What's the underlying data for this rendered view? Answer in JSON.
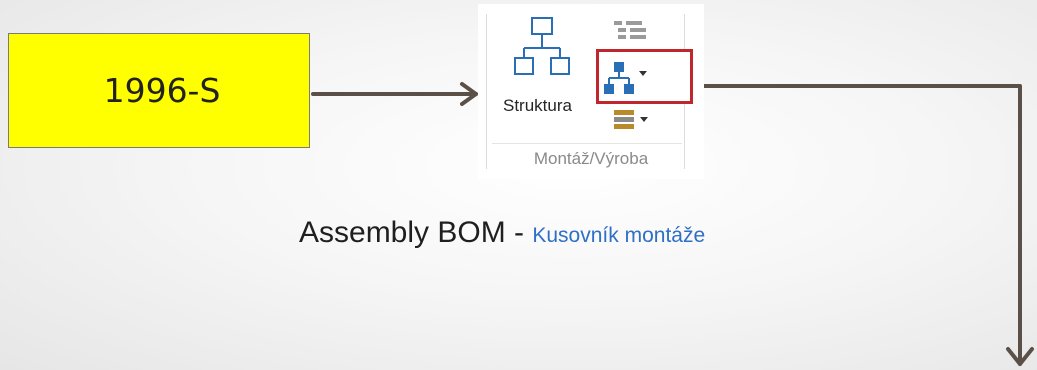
{
  "item_box": {
    "code": "1996-S",
    "color": "#ffff00"
  },
  "ribbon": {
    "struktura_label": "Struktura",
    "group_label": "Montáž/Výroba",
    "highlight_color": "#c0272d",
    "icons": {
      "struktura": "org-chart-icon",
      "top": "list-structure-icon",
      "middle": "hierarchy-icon",
      "bottom": "routing-icon"
    }
  },
  "caption": {
    "main": "Assembly BOM - ",
    "sub": "Kusovník montáže"
  },
  "arrow_color": "#5a5047"
}
